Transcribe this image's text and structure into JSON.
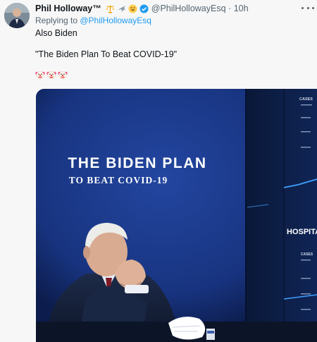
{
  "author": {
    "display_name": "Phil Holloway™",
    "badge_emojis": [
      "scales-emoji",
      "airplane-emoji",
      "grinning-emoji"
    ],
    "handle": "@PhilHollowayEsq",
    "separator": "·",
    "timestamp": "10h",
    "verified": true
  },
  "reply": {
    "prefix": "Replying to ",
    "handle": "@PhilHollowayEsq"
  },
  "tweet": {
    "line1": "Also Biden",
    "line2": "\"The Biden Plan To Beat COVID-19\"",
    "emoji_reaction": [
      "clown-face-emoji",
      "clown-face-emoji",
      "clown-face-emoji"
    ]
  },
  "media": {
    "banner_title": "THE BIDEN PLAN",
    "banner_subtitle": "TO BEAT COVID-19",
    "screen_label_cases": "CASES",
    "screen_label_hospital": "HOSPITA",
    "screen_label_cases2": "CASES"
  },
  "colors": {
    "link": "#1d9bf0",
    "verified": "#1d9bf0",
    "muted_text": "#536471",
    "backdrop_blue": "#1c3a86"
  }
}
